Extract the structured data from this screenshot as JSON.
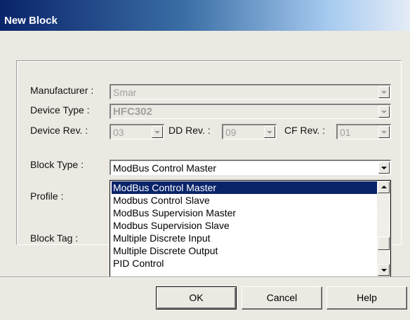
{
  "window": {
    "title": "New Block"
  },
  "form": {
    "manufacturer": {
      "label": "Manufacturer :",
      "value": "Smar"
    },
    "device_type": {
      "label": "Device Type :",
      "value": "HFC302"
    },
    "device_rev": {
      "label": "Device Rev. :",
      "value": "03"
    },
    "dd_rev": {
      "label": "DD Rev. :",
      "value": "09"
    },
    "cf_rev": {
      "label": "CF Rev. :",
      "value": "01"
    },
    "block_type": {
      "label": "Block Type :",
      "value": "ModBus Control Master"
    },
    "profile": {
      "label": "Profile :"
    },
    "block_tag": {
      "label": "Block Tag :"
    }
  },
  "dropdown_list": {
    "items": [
      "ModBus Control Master",
      "Modbus Control Slave",
      "ModBus Supervision Master",
      "Modbus Supervision Slave",
      "Multiple Discrete Input",
      "Multiple Discrete Output",
      "PID Control"
    ],
    "selected_index": 0
  },
  "buttons": {
    "ok": "OK",
    "cancel": "Cancel",
    "help": "Help"
  },
  "colors": {
    "selection": "#0a246a",
    "title_gradient_start": "#0a246a",
    "title_gradient_end": "#e4ecf6"
  }
}
